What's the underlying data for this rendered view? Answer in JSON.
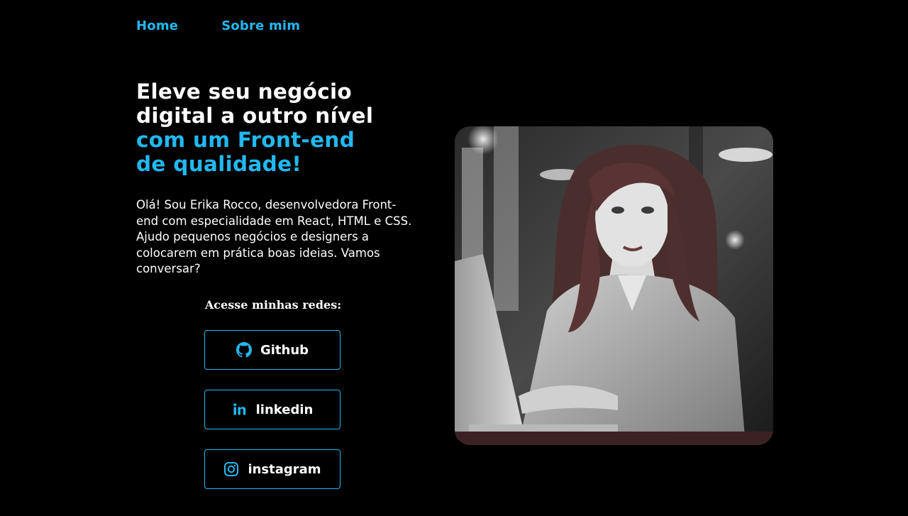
{
  "nav": {
    "items": [
      {
        "label": "Home"
      },
      {
        "label": "Sobre mim"
      }
    ]
  },
  "hero": {
    "headline_line1": "Eleve seu negócio",
    "headline_line2": "digital a outro nível",
    "headline_line3": "com um Front-end",
    "headline_line4": "de qualidade!",
    "intro": "Olá! Sou Erika Rocco, desenvolvedora Front-end com especialidade em React, HTML e CSS. Ajudo pequenos negócios e designers a colocarem em prática boas ideias. Vamos conversar?"
  },
  "social": {
    "title": "Acesse minhas redes:",
    "links": [
      {
        "label": "Github",
        "icon": "github-icon"
      },
      {
        "label": "linkedin",
        "icon": "linkedin-icon"
      },
      {
        "label": "instagram",
        "icon": "instagram-icon"
      }
    ]
  },
  "colors": {
    "accent": "#22b8f0",
    "background": "#000000",
    "text": "#ffffff"
  }
}
